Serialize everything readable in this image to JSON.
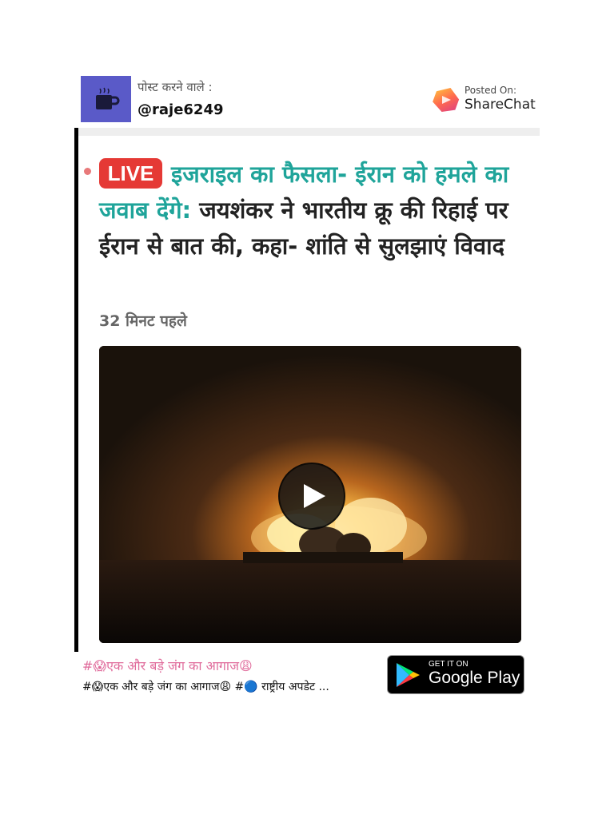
{
  "header": {
    "posted_by_label": "पोस्ट करने वाले :",
    "username": "@raje6249",
    "posted_on_label": "Posted On:",
    "platform": "ShareChat",
    "avatar_icon": "coffee-cup-icon"
  },
  "post": {
    "live_label": "LIVE",
    "headline_teal": "इजराइल का फैसला- ईरान को हमले का जवाब देंगे:",
    "headline_dark": " जयशंकर ने भारतीय क्रू की रिहाई पर ईरान से बात की, कहा- शांति से सुलझाएं विवाद",
    "time_ago": "32 मिनट पहले",
    "video_icon": "play-icon"
  },
  "footer": {
    "hashtag_line": "#😱एक और बड़े जंग का आगाज😩",
    "description": "#😱एक और बड़े जंग का आगाज😩 #🔵 राष्ट्रीय अपडेट ...",
    "store_small": "GET IT ON",
    "store_big": "Google Play"
  },
  "colors": {
    "live_red": "#e53935",
    "teal": "#1fa49a",
    "avatar_bg": "#5a5ac8",
    "hashtag_pink": "#e06b9b"
  }
}
